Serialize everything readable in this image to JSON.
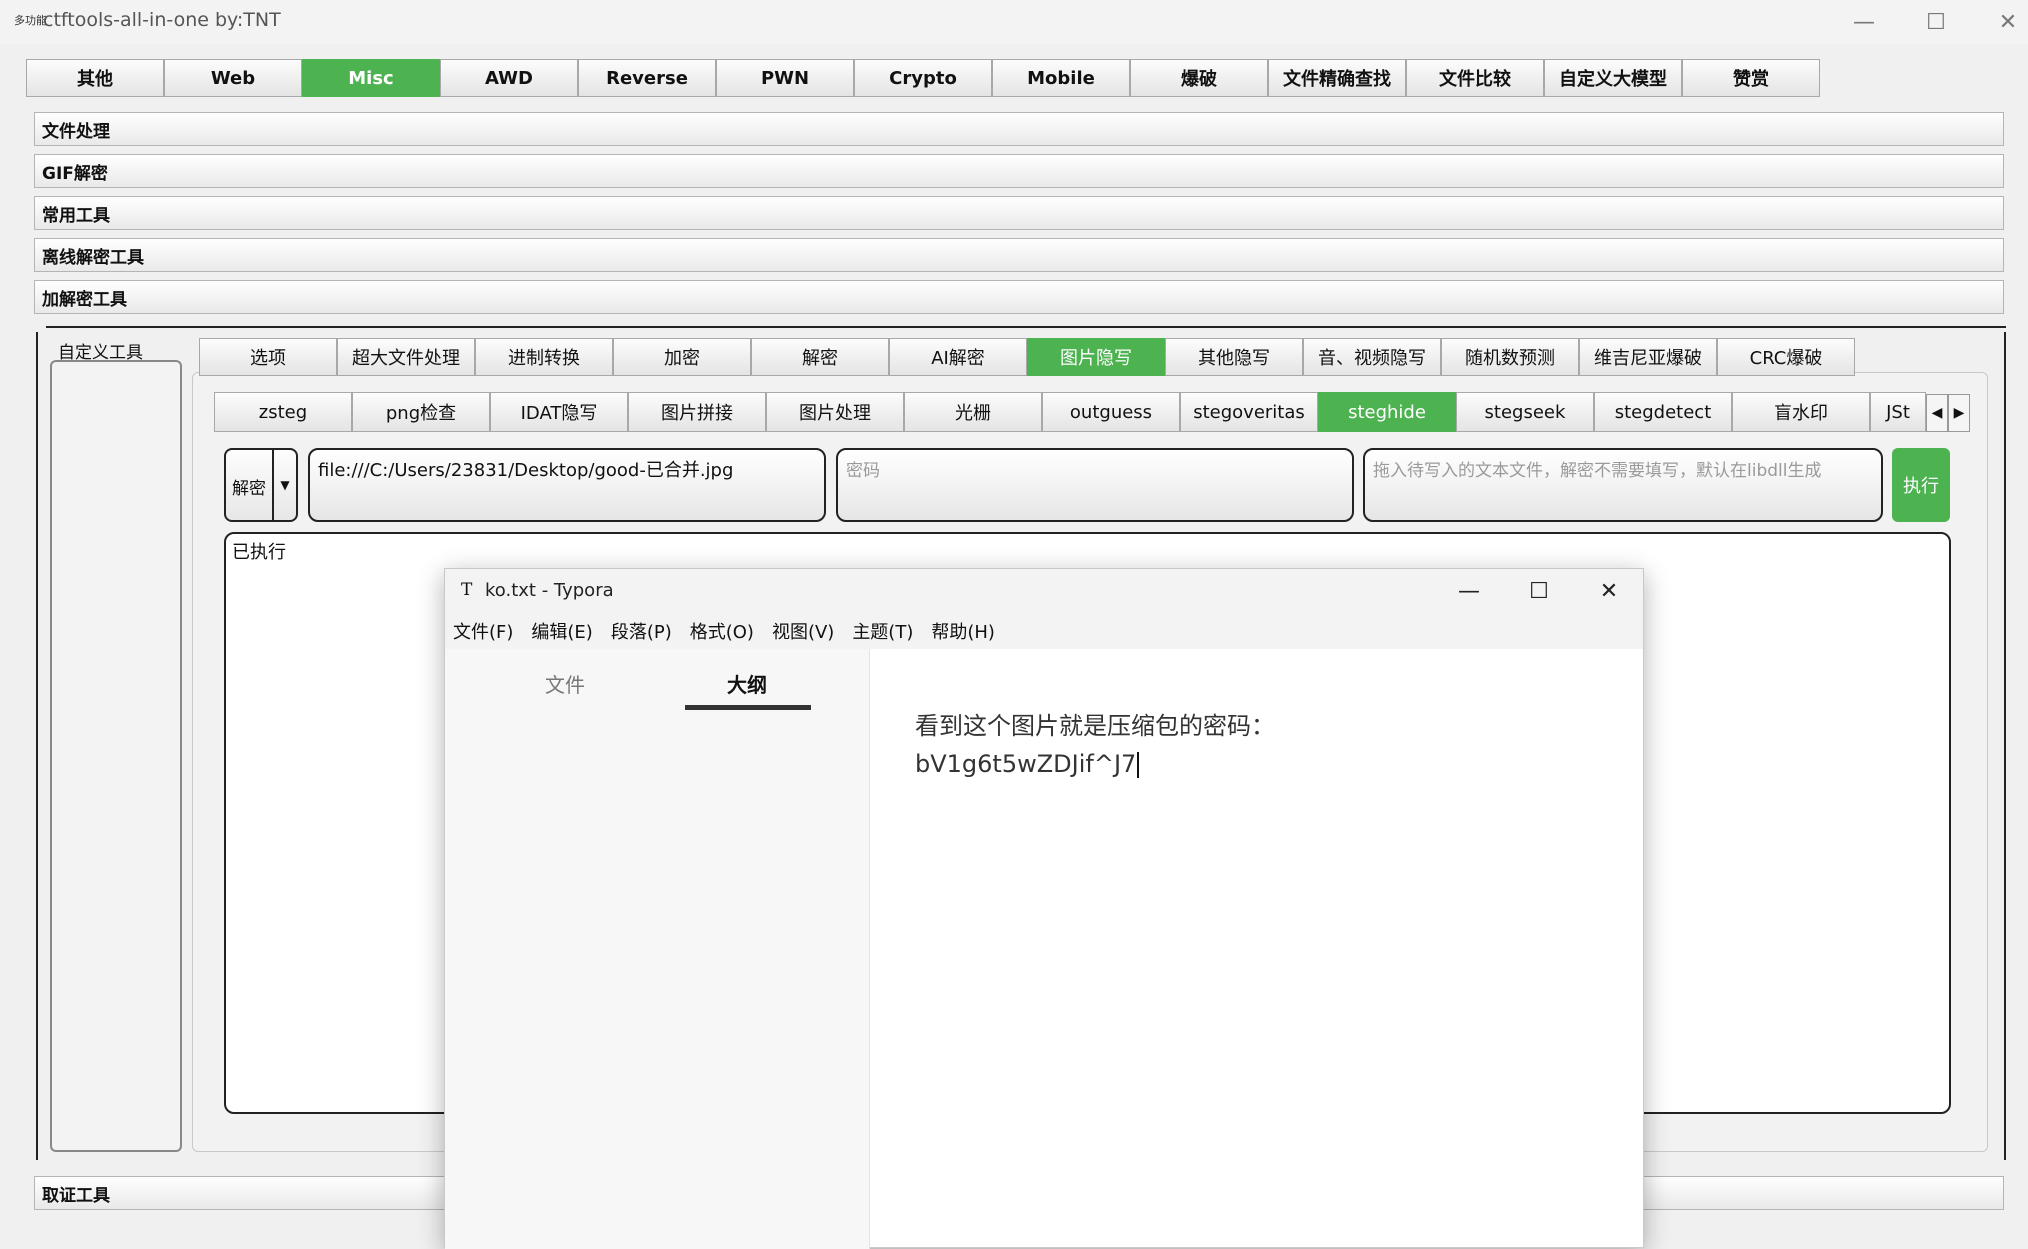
{
  "window": {
    "icon_text": "多功能",
    "title": "ctftools-all-in-one   by:TNT",
    "controls": [
      "—",
      "☐",
      "✕"
    ]
  },
  "main_tabs": [
    "其他",
    "Web",
    "Misc",
    "AWD",
    "Reverse",
    "PWN",
    "Crypto",
    "Mobile",
    "爆破",
    "文件精确查找",
    "文件比较",
    "自定义大模型",
    "赞赏"
  ],
  "main_tab_active": "Misc",
  "accordion": [
    "文件处理",
    "GIF解密",
    "常用工具",
    "离线解密工具",
    "加解密工具"
  ],
  "accordion_bottom": "取证工具",
  "custom_tools_label": "自定义工具",
  "sub_tabs": [
    "选项",
    "超大文件处理",
    "进制转换",
    "加密",
    "解密",
    "AI解密",
    "图片隐写",
    "其他隐写",
    "音、视频隐写",
    "随机数预测",
    "维吉尼亚爆破",
    "CRC爆破"
  ],
  "sub_tab_active": "图片隐写",
  "tool_tabs": [
    "zsteg",
    "png检查",
    "IDAT隐写",
    "图片拼接",
    "图片处理",
    "光栅",
    "outguess",
    "stegoveritas",
    "steghide",
    "stegseek",
    "stegdetect",
    "盲水印",
    "JSt"
  ],
  "tool_tab_active": "steghide",
  "controls": {
    "mode": "解密",
    "file_path": "file:///C:/Users/23831/Desktop/good-已合并.jpg",
    "password_placeholder": "密码",
    "text_file_placeholder": "拖入待写入的文本文件，解密不需要填写，默认在libdll生成",
    "execute": "执行"
  },
  "output": "已执行",
  "typora": {
    "icon": "T",
    "title": "ko.txt - Typora",
    "menus": [
      "文件(F)",
      "编辑(E)",
      "段落(P)",
      "格式(O)",
      "视图(V)",
      "主题(T)",
      "帮助(H)"
    ],
    "sidebar_tabs": [
      "文件",
      "大纲"
    ],
    "content_lines": [
      "看到这个图片就是压缩包的密码：",
      "bV1g6t5wZDJif^J7"
    ]
  },
  "colors": {
    "accent_green": "#4db250"
  }
}
